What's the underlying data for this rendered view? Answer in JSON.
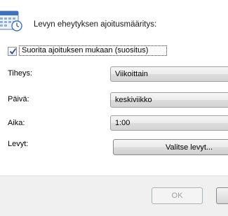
{
  "header": {
    "title": "Levyn eheytyksen ajoitusmääritys:",
    "icon": "calendar-clock-icon"
  },
  "schedule_checkbox": {
    "label": "Suorita ajoituksen mukaan (suositus)",
    "checked": true
  },
  "frequency": {
    "label": "Tiheys:",
    "value": "Viikoittain"
  },
  "day": {
    "label": "Päivä:",
    "value": "keskiviikko"
  },
  "time": {
    "label": "Aika:",
    "value": "1:00"
  },
  "disks": {
    "label": "Levyt:",
    "button_label": "Valitse levyt..."
  },
  "footer": {
    "ok_label": "OK"
  },
  "colors": {
    "accent": "#3b72c4",
    "footer_bg": "#f0f0f0",
    "disabled_text": "#a0a0a0"
  }
}
